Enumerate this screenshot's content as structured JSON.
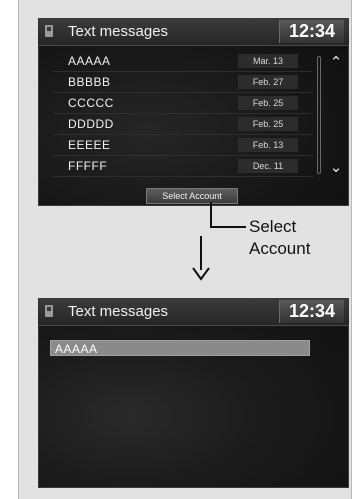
{
  "screen1": {
    "title": "Text messages",
    "clock": "12:34",
    "messages": [
      {
        "name": "AAAAA",
        "date": "Mar. 13"
      },
      {
        "name": "BBBBB",
        "date": "Feb. 27"
      },
      {
        "name": "CCCCC",
        "date": "Feb. 25"
      },
      {
        "name": "DDDDD",
        "date": "Feb. 25"
      },
      {
        "name": "EEEEE",
        "date": "Feb. 13"
      },
      {
        "name": "FFFFF",
        "date": "Dec. 11"
      }
    ],
    "select_account_label": "Select Account",
    "scroll_up_icon": "double-chevron-up-icon",
    "scroll_down_icon": "double-chevron-down-icon"
  },
  "callout": {
    "line1": "Select",
    "line2": "Account"
  },
  "screen2": {
    "title": "Text messages",
    "clock": "12:34",
    "selected_item": "AAAAA"
  },
  "colors": {
    "screen_bg": "#161616",
    "highlight": "#8a8a8a",
    "frame_bg": "#e2e2e2"
  }
}
